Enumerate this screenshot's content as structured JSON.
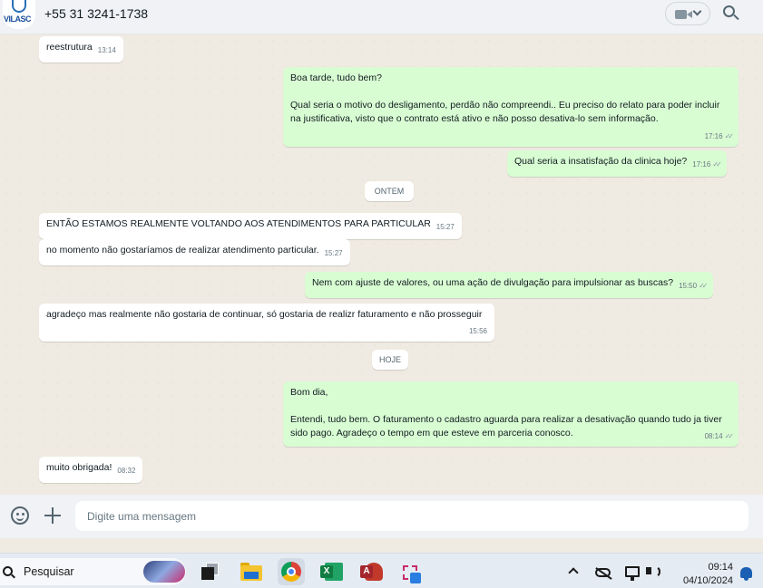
{
  "header": {
    "avatar_text": "VILASC",
    "contact_name": "+55 31 3241-1738",
    "video_icon": "video-camera-icon",
    "search_icon": "search-icon"
  },
  "messages": [
    {
      "dir": "in",
      "lines": [
        "reestrutura"
      ],
      "time": "13:14"
    },
    {
      "dir": "out",
      "lines": [
        "Boa tarde, tudo bem?",
        "",
        "Qual seria o motivo do desligamento, perdão não compreendi.. Eu preciso do relato para poder incluir na justificativa, visto que o contrato está ativo e não posso desativa-lo sem informação."
      ],
      "time": "17:16"
    },
    {
      "dir": "out",
      "lines": [
        "Qual seria a insatisfação da clinica hoje?"
      ],
      "time": "17:16"
    },
    {
      "dir": "in",
      "lines": [
        "ENTÃO ESTAMOS REALMENTE VOLTANDO AOS ATENDIMENTOS PARA PARTICULAR"
      ],
      "time": "15:27"
    },
    {
      "dir": "in",
      "lines": [
        "no momento não gostaríamos de realizar atendimento particular."
      ],
      "time": "15:27"
    },
    {
      "dir": "out",
      "lines": [
        "Nem com ajuste de valores, ou uma ação de divulgação para impulsionar as buscas?"
      ],
      "time": "15:50"
    },
    {
      "dir": "in",
      "lines": [
        "agradeço mas realmente não gostaria de continuar, só gostaria de realizr faturamento e não prosseguir"
      ],
      "time": "15:56"
    },
    {
      "dir": "out",
      "lines": [
        "Bom dia,",
        "",
        "Entendi, tudo bem. O faturamento o cadastro aguarda para realizar a desativação quando tudo ja tiver sido pago. Agradeço o tempo em que esteve em parceria conosco."
      ],
      "time": "08:14"
    },
    {
      "dir": "in",
      "lines": [
        "muito obrigada!"
      ],
      "time": "08:32"
    }
  ],
  "date_dividers": {
    "yesterday": "ONTEM",
    "today": "HOJE"
  },
  "read_ticks": "✓✓",
  "composer": {
    "emoji_icon": "emoji-icon",
    "attach_icon": "plus-icon",
    "placeholder": "Digite uma mensagem"
  },
  "taskbar": {
    "search_label": "Pesquisar",
    "time": "09:14",
    "date": "04/10/2024"
  }
}
